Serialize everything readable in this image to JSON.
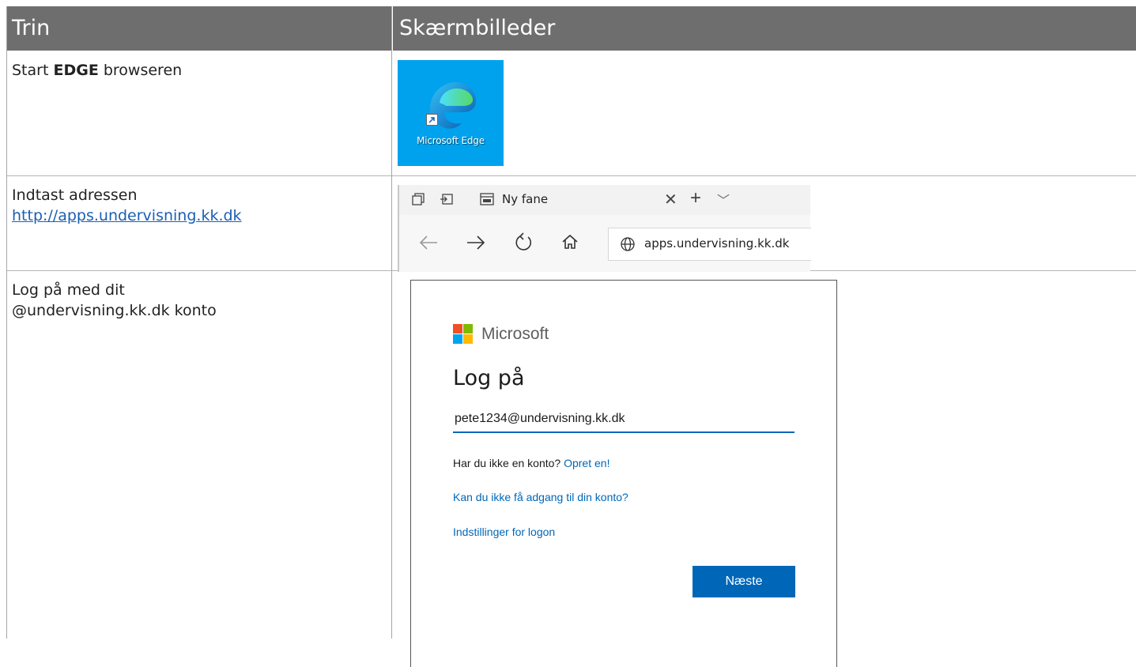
{
  "header": {
    "col_step": "Trin",
    "col_screens": "Skærmbilleder"
  },
  "rows": [
    {
      "text_before": "Start ",
      "text_bold": "EDGE",
      "text_after": " browseren",
      "desktop_icon_label": "Microsoft Edge"
    },
    {
      "text": "Indtast adressen",
      "link": "http://apps.undervisning.kk.dk",
      "browser": {
        "tab_title": "Ny fane",
        "address": "apps.undervisning.kk.dk"
      }
    },
    {
      "text_line1": "Log på med dit",
      "text_line2": "@undervisning.kk.dk konto",
      "login": {
        "brand": "Microsoft",
        "title": "Log på",
        "email_value": "pete1234@undervisning.kk.dk",
        "no_account_text": "Har du ikke en konto?",
        "create_link": "Opret en!",
        "access_link": "Kan du ikke få adgang til din konto?",
        "options_link": "Indstillinger for logon",
        "next_button": "Næste"
      }
    }
  ],
  "colors": {
    "header_bg": "#6e6e6e",
    "ms_blue": "#0067b8",
    "edge_tile": "#00a2ed"
  }
}
